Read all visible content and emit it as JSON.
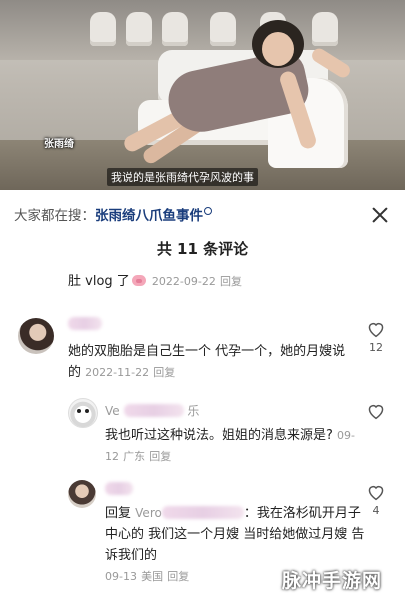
{
  "video": {
    "name_tag": "张雨绮",
    "subtitle": "我说的是张雨绮代孕风波的事"
  },
  "search": {
    "prefix": "大家都在搜：",
    "keyword": "张雨绮八爪鱼事件"
  },
  "comments_count_title": "共 11 条评论",
  "partial_comment": {
    "text": "肚 vlog 了",
    "date": "2022-09-22",
    "reply": "回复"
  },
  "comments": [
    {
      "text": "她的双胞胎是自己生一个 代孕一个，她的月嫂说的",
      "date": "2022-11-22",
      "reply": "回复",
      "likes": "12"
    },
    {
      "username": "Ve",
      "username_tail": "乐",
      "text": "我也听过这种说法。姐姐的消息来源是?",
      "date": "09-12",
      "location": "广东",
      "reply": "回复",
      "likes": ""
    },
    {
      "reply_prefix": "回复",
      "reply_to": "Vero",
      "text_after": "：我在洛杉矶开月子中心的 我们这一个月嫂 当时给她做过月嫂 告诉我们的",
      "date": "09-13",
      "location": "美国",
      "reply": "回复",
      "likes": "4"
    }
  ],
  "watermark": "脉冲手游网"
}
